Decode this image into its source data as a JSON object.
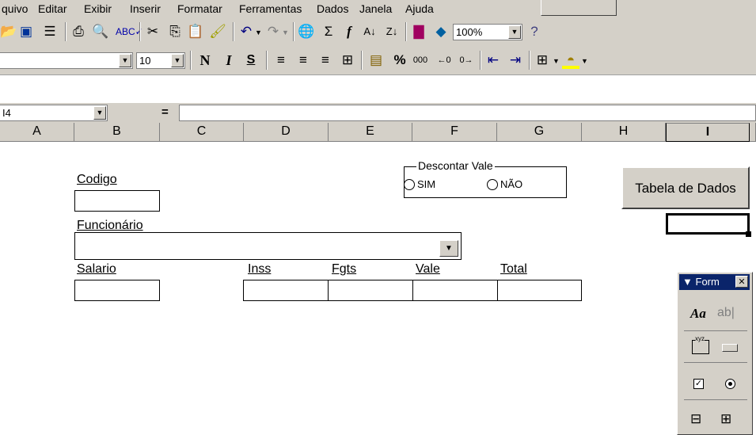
{
  "menu": [
    "quivo",
    "Editar",
    "Exibir",
    "Inserir",
    "Formatar",
    "Ferramentas",
    "Dados",
    "Janela",
    "Ajuda"
  ],
  "toolbar1": {
    "zoom": "100%",
    "icons": [
      "open-icon",
      "save-icon",
      "permission-icon",
      "print-icon",
      "print-preview-icon",
      "spelling-icon",
      "cut-icon",
      "copy-icon",
      "paste-icon",
      "format-painter-icon",
      "undo-icon",
      "redo-icon",
      "hyperlink-icon",
      "autosum-icon",
      "function-icon",
      "sort-ascending-icon",
      "sort-descending-icon",
      "chart-wizard-icon",
      "drawing-icon",
      "help-icon"
    ]
  },
  "toolbar2": {
    "font_size": "10",
    "bold": "N",
    "italic": "I",
    "underline": "S",
    "percent": "%",
    "thousands": "000"
  },
  "formula_bar": {
    "name_box": "I4",
    "equals": "="
  },
  "columns": [
    "A",
    "B",
    "C",
    "D",
    "E",
    "F",
    "G",
    "H",
    "I"
  ],
  "form": {
    "codigo_label": "Codigo",
    "funcionario_label": "Funcionário",
    "salario_label": "Salario",
    "inss_label": "Inss",
    "fgts_label": "Fgts",
    "vale_label": "Vale",
    "total_label": "Total",
    "group_title": "Descontar Vale",
    "radio_sim": "SIM",
    "radio_nao": "NÃO",
    "button_label": "Tabela de Dados"
  },
  "forms_toolbar": {
    "title": "Form",
    "label_glyph": "Aa",
    "editbox_glyph": "ab|",
    "group_glyph": "xyz"
  }
}
